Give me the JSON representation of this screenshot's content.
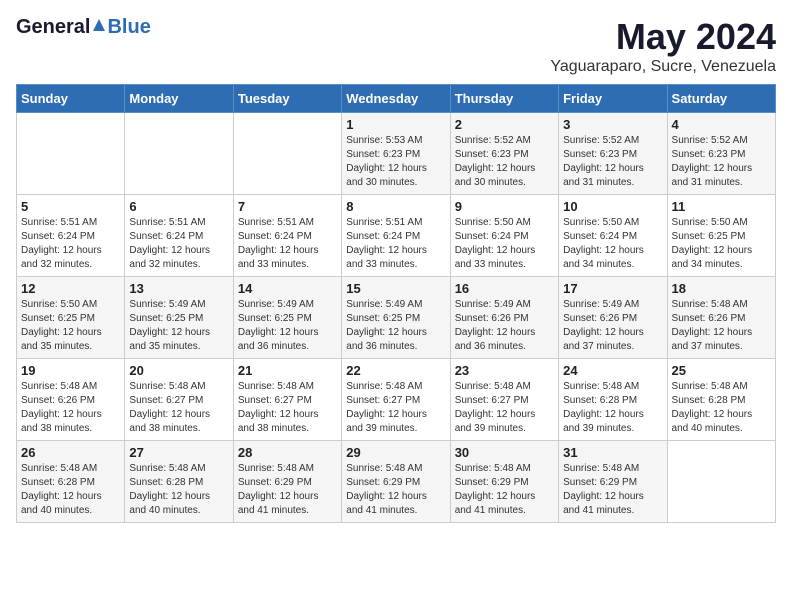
{
  "logo": {
    "general": "General",
    "blue": "Blue"
  },
  "title": "May 2024",
  "subtitle": "Yaguaraparo, Sucre, Venezuela",
  "days_of_week": [
    "Sunday",
    "Monday",
    "Tuesday",
    "Wednesday",
    "Thursday",
    "Friday",
    "Saturday"
  ],
  "weeks": [
    [
      {
        "day": "",
        "info": ""
      },
      {
        "day": "",
        "info": ""
      },
      {
        "day": "",
        "info": ""
      },
      {
        "day": "1",
        "info": "Sunrise: 5:53 AM\nSunset: 6:23 PM\nDaylight: 12 hours\nand 30 minutes."
      },
      {
        "day": "2",
        "info": "Sunrise: 5:52 AM\nSunset: 6:23 PM\nDaylight: 12 hours\nand 30 minutes."
      },
      {
        "day": "3",
        "info": "Sunrise: 5:52 AM\nSunset: 6:23 PM\nDaylight: 12 hours\nand 31 minutes."
      },
      {
        "day": "4",
        "info": "Sunrise: 5:52 AM\nSunset: 6:23 PM\nDaylight: 12 hours\nand 31 minutes."
      }
    ],
    [
      {
        "day": "5",
        "info": "Sunrise: 5:51 AM\nSunset: 6:24 PM\nDaylight: 12 hours\nand 32 minutes."
      },
      {
        "day": "6",
        "info": "Sunrise: 5:51 AM\nSunset: 6:24 PM\nDaylight: 12 hours\nand 32 minutes."
      },
      {
        "day": "7",
        "info": "Sunrise: 5:51 AM\nSunset: 6:24 PM\nDaylight: 12 hours\nand 33 minutes."
      },
      {
        "day": "8",
        "info": "Sunrise: 5:51 AM\nSunset: 6:24 PM\nDaylight: 12 hours\nand 33 minutes."
      },
      {
        "day": "9",
        "info": "Sunrise: 5:50 AM\nSunset: 6:24 PM\nDaylight: 12 hours\nand 33 minutes."
      },
      {
        "day": "10",
        "info": "Sunrise: 5:50 AM\nSunset: 6:24 PM\nDaylight: 12 hours\nand 34 minutes."
      },
      {
        "day": "11",
        "info": "Sunrise: 5:50 AM\nSunset: 6:25 PM\nDaylight: 12 hours\nand 34 minutes."
      }
    ],
    [
      {
        "day": "12",
        "info": "Sunrise: 5:50 AM\nSunset: 6:25 PM\nDaylight: 12 hours\nand 35 minutes."
      },
      {
        "day": "13",
        "info": "Sunrise: 5:49 AM\nSunset: 6:25 PM\nDaylight: 12 hours\nand 35 minutes."
      },
      {
        "day": "14",
        "info": "Sunrise: 5:49 AM\nSunset: 6:25 PM\nDaylight: 12 hours\nand 36 minutes."
      },
      {
        "day": "15",
        "info": "Sunrise: 5:49 AM\nSunset: 6:25 PM\nDaylight: 12 hours\nand 36 minutes."
      },
      {
        "day": "16",
        "info": "Sunrise: 5:49 AM\nSunset: 6:26 PM\nDaylight: 12 hours\nand 36 minutes."
      },
      {
        "day": "17",
        "info": "Sunrise: 5:49 AM\nSunset: 6:26 PM\nDaylight: 12 hours\nand 37 minutes."
      },
      {
        "day": "18",
        "info": "Sunrise: 5:48 AM\nSunset: 6:26 PM\nDaylight: 12 hours\nand 37 minutes."
      }
    ],
    [
      {
        "day": "19",
        "info": "Sunrise: 5:48 AM\nSunset: 6:26 PM\nDaylight: 12 hours\nand 38 minutes."
      },
      {
        "day": "20",
        "info": "Sunrise: 5:48 AM\nSunset: 6:27 PM\nDaylight: 12 hours\nand 38 minutes."
      },
      {
        "day": "21",
        "info": "Sunrise: 5:48 AM\nSunset: 6:27 PM\nDaylight: 12 hours\nand 38 minutes."
      },
      {
        "day": "22",
        "info": "Sunrise: 5:48 AM\nSunset: 6:27 PM\nDaylight: 12 hours\nand 39 minutes."
      },
      {
        "day": "23",
        "info": "Sunrise: 5:48 AM\nSunset: 6:27 PM\nDaylight: 12 hours\nand 39 minutes."
      },
      {
        "day": "24",
        "info": "Sunrise: 5:48 AM\nSunset: 6:28 PM\nDaylight: 12 hours\nand 39 minutes."
      },
      {
        "day": "25",
        "info": "Sunrise: 5:48 AM\nSunset: 6:28 PM\nDaylight: 12 hours\nand 40 minutes."
      }
    ],
    [
      {
        "day": "26",
        "info": "Sunrise: 5:48 AM\nSunset: 6:28 PM\nDaylight: 12 hours\nand 40 minutes."
      },
      {
        "day": "27",
        "info": "Sunrise: 5:48 AM\nSunset: 6:28 PM\nDaylight: 12 hours\nand 40 minutes."
      },
      {
        "day": "28",
        "info": "Sunrise: 5:48 AM\nSunset: 6:29 PM\nDaylight: 12 hours\nand 41 minutes."
      },
      {
        "day": "29",
        "info": "Sunrise: 5:48 AM\nSunset: 6:29 PM\nDaylight: 12 hours\nand 41 minutes."
      },
      {
        "day": "30",
        "info": "Sunrise: 5:48 AM\nSunset: 6:29 PM\nDaylight: 12 hours\nand 41 minutes."
      },
      {
        "day": "31",
        "info": "Sunrise: 5:48 AM\nSunset: 6:29 PM\nDaylight: 12 hours\nand 41 minutes."
      },
      {
        "day": "",
        "info": ""
      }
    ]
  ]
}
